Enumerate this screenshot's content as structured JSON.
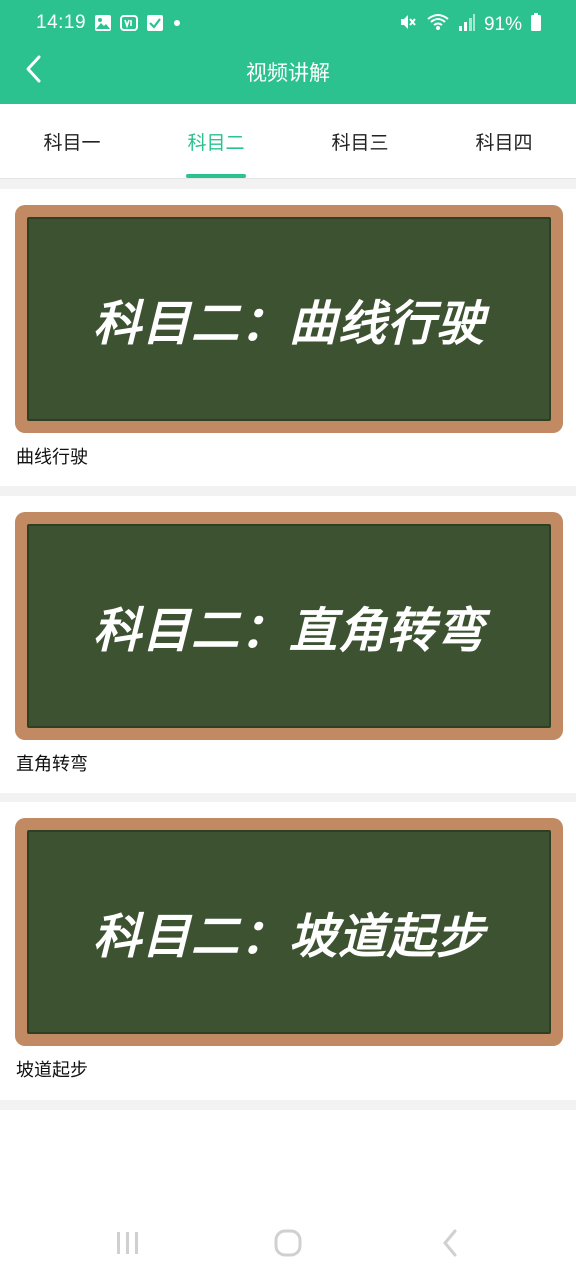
{
  "status_bar": {
    "time": "14:19",
    "battery": "91%",
    "left_icons": [
      "image-icon",
      "tv-app-icon",
      "checkbox-icon",
      "dot-icon"
    ],
    "right_icons": [
      "mute-icon",
      "wifi-icon",
      "signal-icon",
      "battery-icon"
    ]
  },
  "app_bar": {
    "title": "视频讲解",
    "back_icon": "back-arrow-icon"
  },
  "tabs": [
    {
      "label": "科目一",
      "active": false
    },
    {
      "label": "科目二",
      "active": true
    },
    {
      "label": "科目三",
      "active": false
    },
    {
      "label": "科目四",
      "active": false
    }
  ],
  "videos": [
    {
      "board_text": "科目二：曲线行驶",
      "caption": "曲线行驶"
    },
    {
      "board_text": "科目二：直角转弯",
      "caption": "直角转弯"
    },
    {
      "board_text": "科目二：坡道起步",
      "caption": "坡道起步"
    }
  ],
  "nav_bar": {
    "buttons": [
      "recent-apps-icon",
      "home-icon",
      "back-icon"
    ]
  },
  "colors": {
    "accent": "#2bc28f",
    "board_frame": "#c28a63",
    "board": "#3c5231",
    "divider": "#f2f2f2"
  }
}
